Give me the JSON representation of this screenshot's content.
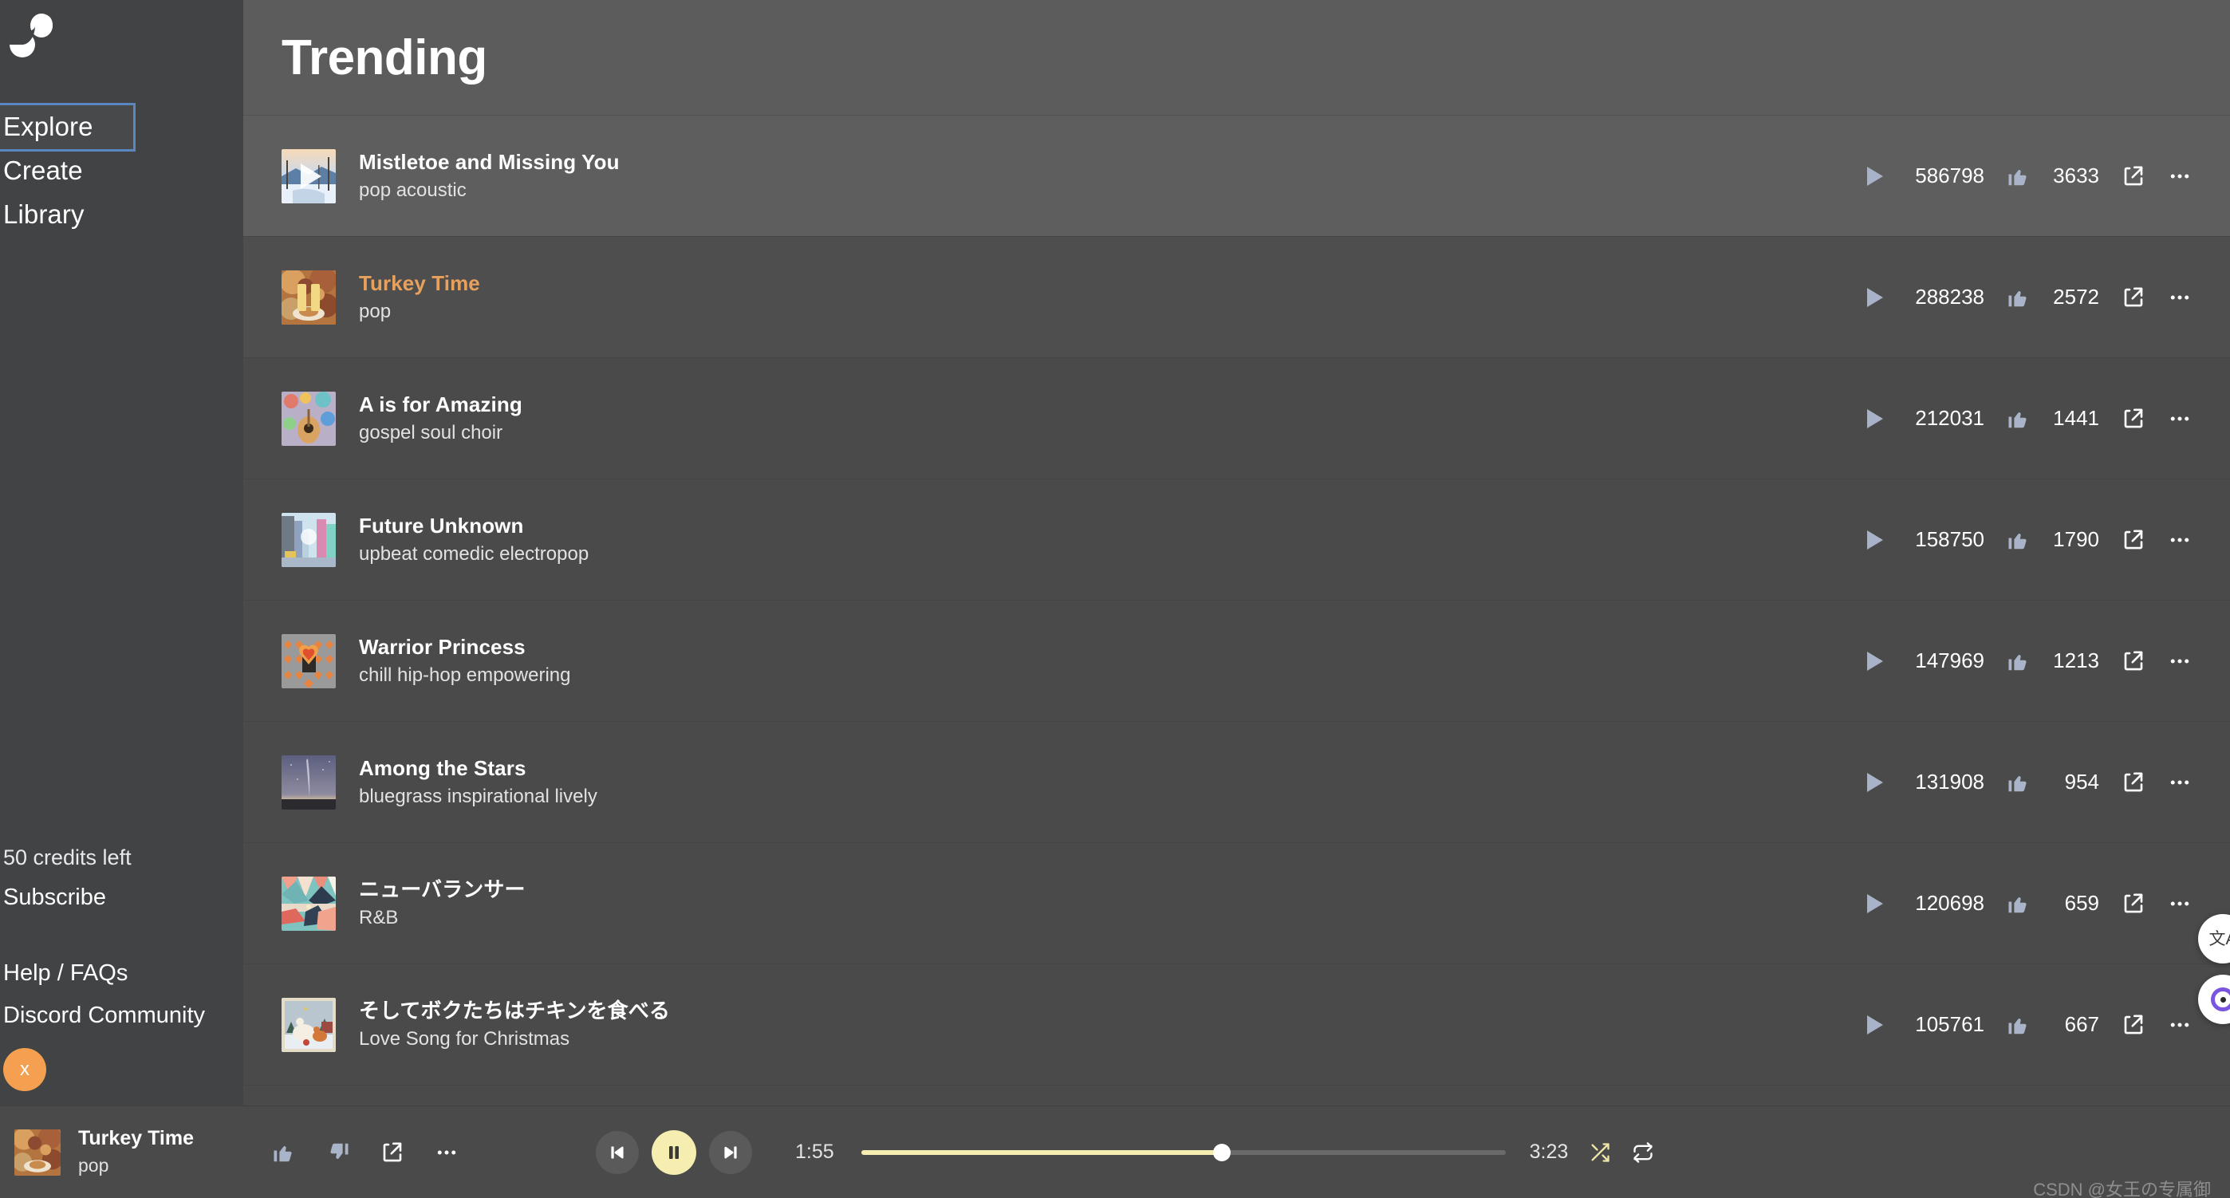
{
  "app": {
    "logo_name": "suno-wave-logo",
    "accent_orange": "#e8a15c",
    "accent_yellow": "#f6eeb0",
    "focus_blue": "#5a87c0",
    "sidebar_bg": "#414345",
    "main_bg": "#4a4a4a",
    "header_bg": "#5c5c5c"
  },
  "sidebar": {
    "nav": [
      {
        "label": "Explore",
        "focused": true
      },
      {
        "label": "Create",
        "focused": false
      },
      {
        "label": "Library",
        "focused": false
      }
    ],
    "credits": "50 credits left",
    "subscribe": "Subscribe",
    "links": [
      {
        "label": "Help / FAQs"
      },
      {
        "label": "Discord Community"
      }
    ],
    "avatar_initial": "x"
  },
  "header": {
    "title": "Trending"
  },
  "tracks": [
    {
      "title": "Mistletoe and Missing You",
      "genre": "pop acoustic",
      "plays": "586798",
      "likes": "3633",
      "state": "hovered",
      "art": "winter-snow-scene"
    },
    {
      "title": "Turkey Time",
      "genre": "pop",
      "plays": "288238",
      "likes": "2572",
      "state": "playing",
      "art": "thanksgiving-feast"
    },
    {
      "title": "A is for Amazing",
      "genre": "gospel soul choir",
      "plays": "212031",
      "likes": "1441",
      "state": "normal",
      "art": "colorful-guitar"
    },
    {
      "title": "Future Unknown",
      "genre": "upbeat comedic electropop",
      "plays": "158750",
      "likes": "1790",
      "state": "normal",
      "art": "neon-city-street"
    },
    {
      "title": "Warrior Princess",
      "genre": "chill hip-hop empowering",
      "plays": "147969",
      "likes": "1213",
      "state": "normal",
      "art": "orange-heart-pattern"
    },
    {
      "title": "Among the Stars",
      "genre": "bluegrass inspirational lively",
      "plays": "131908",
      "likes": "954",
      "state": "normal",
      "art": "night-sky-milky-way"
    },
    {
      "title": "ニューバランサー",
      "genre": "R&B",
      "plays": "120698",
      "likes": "659",
      "state": "normal",
      "art": "geometric-mountains"
    },
    {
      "title": "そしてボクたちはチキンを食べる",
      "genre": "Love Song for Christmas",
      "plays": "105761",
      "likes": "667",
      "state": "normal",
      "art": "winter-chickens"
    }
  ],
  "player": {
    "now_playing_title": "Turkey Time",
    "now_playing_genre": "pop",
    "current_time": "1:55",
    "duration": "3:23",
    "progress_percent": 56,
    "is_playing": true,
    "shuffle_active": true,
    "repeat_active": false
  },
  "floating": {
    "translate_label": "文A",
    "widget_two_name": "recorder-ring-widget"
  },
  "watermark": "CSDN @女王の专属御"
}
